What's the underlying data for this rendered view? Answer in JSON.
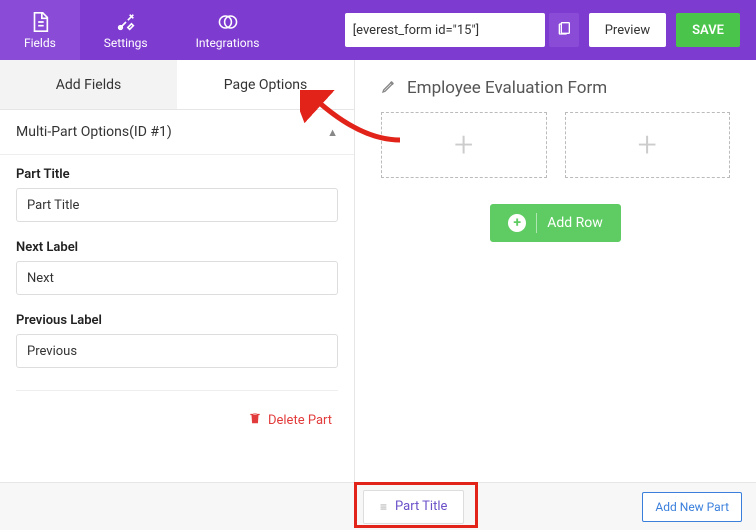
{
  "header": {
    "nav": {
      "fields": "Fields",
      "settings": "Settings",
      "integrations": "Integrations"
    },
    "shortcode": "[everest_form id=\"15\"]",
    "preview": "Preview",
    "save": "SAVE"
  },
  "sidebar": {
    "tabs": {
      "add_fields": "Add Fields",
      "page_options": "Page Options"
    },
    "multi_part_header": "Multi-Part Options(ID #1)",
    "fields": {
      "part_title_label": "Part Title",
      "part_title_value": "Part Title",
      "next_label_label": "Next Label",
      "next_label_value": "Next",
      "prev_label_label": "Previous Label",
      "prev_label_value": "Previous"
    },
    "delete_part": "Delete Part"
  },
  "canvas": {
    "form_title": "Employee Evaluation Form",
    "add_row": "Add Row"
  },
  "footer": {
    "part_tab": "Part Title",
    "add_new_part": "Add New Part"
  }
}
